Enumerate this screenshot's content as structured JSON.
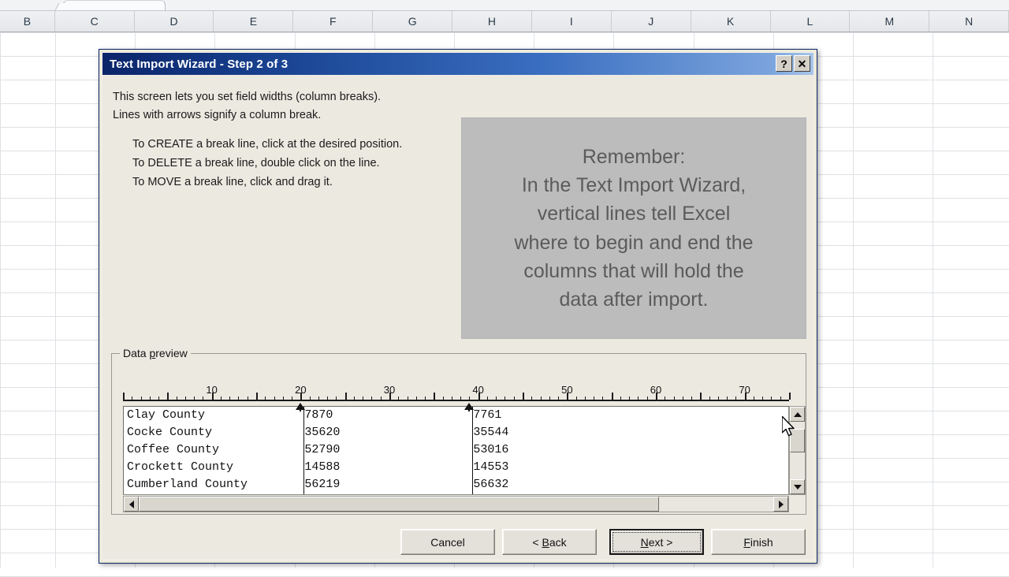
{
  "excel": {
    "column_headers": [
      "B",
      "C",
      "D",
      "E",
      "F",
      "G",
      "H",
      "I",
      "J",
      "K",
      "L",
      "M",
      "N"
    ]
  },
  "dialog": {
    "title": "Text Import Wizard - Step 2 of 3",
    "help_button": "?",
    "close_button": "✕",
    "instructions": [
      "This screen lets you set field widths (column breaks).",
      "Lines with arrows signify a column break.",
      "To CREATE a break line, click at the desired position.",
      "To DELETE a break line, double click on the line.",
      "To MOVE a break line, click and drag it."
    ],
    "remember_callout": {
      "lines": [
        "Remember:",
        "In the Text Import Wizard,",
        "vertical lines tell Excel",
        "where to begin and end the",
        "columns that will hold the",
        "data after import."
      ],
      "background_color": "#bcbcbc",
      "text_color": "#5b5b5b"
    },
    "preview": {
      "legend_pre": "Data ",
      "legend_accel": "p",
      "legend_post": "review",
      "ruler_labels": [
        10,
        20,
        30,
        40,
        50,
        60,
        70
      ],
      "ruler_max": 75,
      "break_positions": [
        20,
        39
      ],
      "rows": [
        {
          "name": "Clay County",
          "col2": "7870",
          "col3": "7761"
        },
        {
          "name": "Cocke County",
          "col2": "35620",
          "col3": "35544"
        },
        {
          "name": "Coffee County",
          "col2": "52790",
          "col3": "53016"
        },
        {
          "name": "Crockett County",
          "col2": "14588",
          "col3": "14553"
        },
        {
          "name": "Cumberland County",
          "col2": "56219",
          "col3": "56632"
        }
      ],
      "h_scroll_thumb_percent": 82,
      "v_scroll_thumb_top_percent": 22
    },
    "buttons": [
      {
        "name": "cancel",
        "pre": "Cancel",
        "accel": "",
        "post": "",
        "default": false
      },
      {
        "name": "back",
        "pre": "< ",
        "accel": "B",
        "post": "ack",
        "default": false
      },
      {
        "name": "next",
        "pre": "",
        "accel": "N",
        "post": "ext >",
        "default": true
      },
      {
        "name": "finish",
        "pre": "",
        "accel": "F",
        "post": "inish",
        "default": false
      }
    ]
  },
  "colors": {
    "titlebar_dark": "#0a246a",
    "titlebar_light": "#a8c6ea",
    "dialog_face": "#ece9e1"
  }
}
